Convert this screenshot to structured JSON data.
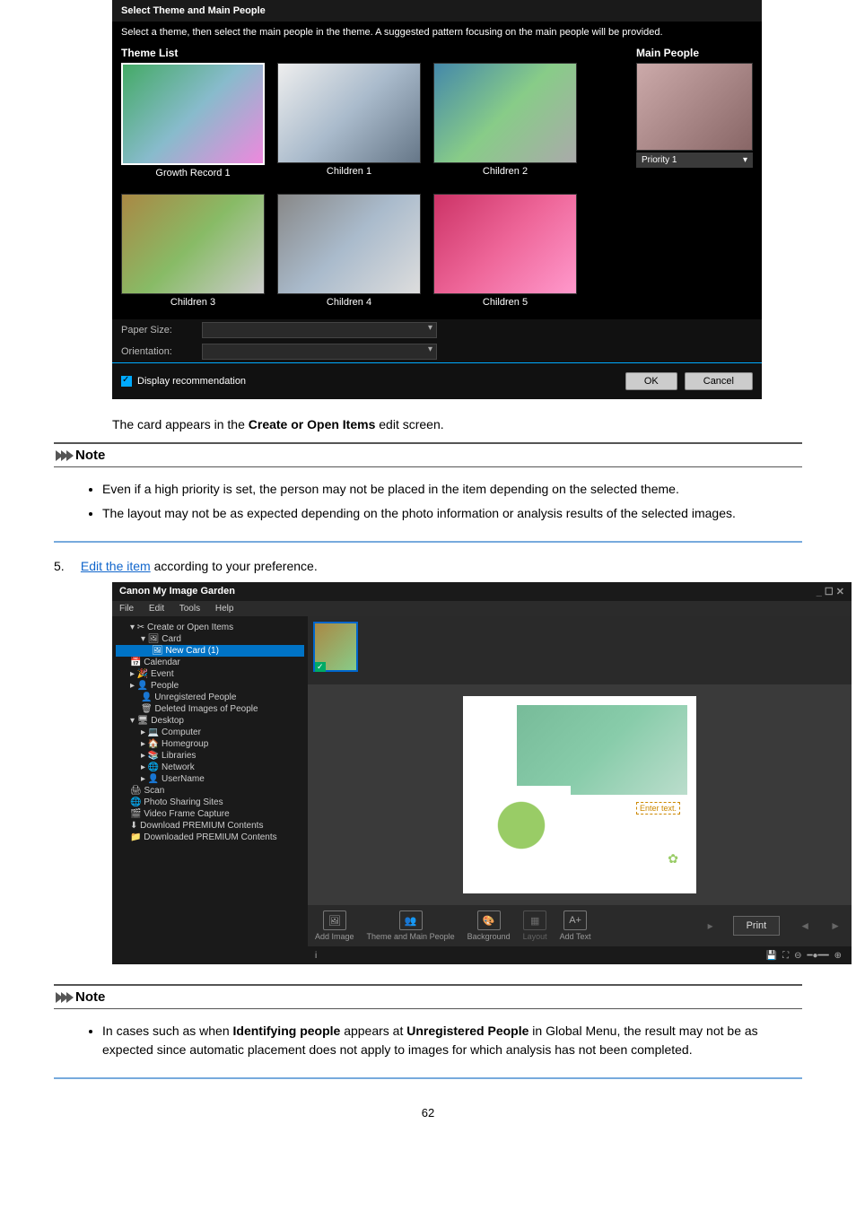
{
  "dialog1": {
    "title": "Select Theme and Main People",
    "subtitle": "Select a theme, then select the main people in the theme. A suggested pattern focusing on the main people will be provided.",
    "theme_list_label": "Theme List",
    "themes": [
      "Growth Record 1",
      "Children 1",
      "Children 2",
      "Children 3",
      "Children 4",
      "Children 5"
    ],
    "main_people_label": "Main People",
    "priority_label": "Priority 1",
    "paper_size_label": "Paper Size:",
    "orientation_label": "Orientation:",
    "display_rec_label": "Display recommendation",
    "ok": "OK",
    "cancel": "Cancel"
  },
  "text1": {
    "p": "The card appears in the ",
    "b": "Create or Open Items",
    "s": " edit screen."
  },
  "note1": {
    "title": "Note",
    "items": [
      "Even if a high priority is set, the person may not be placed in the item depending on the selected theme.",
      "The layout may not be as expected depending on the photo information or analysis results of the selected images."
    ]
  },
  "step5": {
    "num": "5.",
    "link": "Edit the item",
    "rest": " according to your preference."
  },
  "app": {
    "title": "Canon My Image Garden",
    "menus": [
      "File",
      "Edit",
      "Tools",
      "Help"
    ],
    "tree": {
      "create": "Create or Open Items",
      "card": "Card",
      "newcard": "New Card (1)",
      "calendar": "Calendar",
      "event": "Event",
      "people": "People",
      "unreg": "Unregistered People",
      "deleted": "Deleted Images of People",
      "desktop": "Desktop",
      "computer": "Computer",
      "homegroup": "Homegroup",
      "libraries": "Libraries",
      "network": "Network",
      "username": "UserName",
      "scan": "Scan",
      "photoshare": "Photo Sharing Sites",
      "video": "Video Frame Capture",
      "dlprem": "Download PREMIUM Contents",
      "dledprem": "Downloaded PREMIUM Contents"
    },
    "preview_text": "Enter text.",
    "toolbar": {
      "add_image": "Add Image",
      "theme": "Theme and Main People",
      "background": "Background",
      "layout": "Layout",
      "add_text": "Add Text",
      "print": "Print"
    },
    "status_info": "i"
  },
  "note2": {
    "title": "Note",
    "p1": "In cases such as when ",
    "b1": "Identifying people",
    "p2": " appears at ",
    "b2": "Unregistered People",
    "p3": " in Global Menu, the result may not be as expected since automatic placement does not apply to images for which analysis has not been completed."
  },
  "page_number": "62"
}
